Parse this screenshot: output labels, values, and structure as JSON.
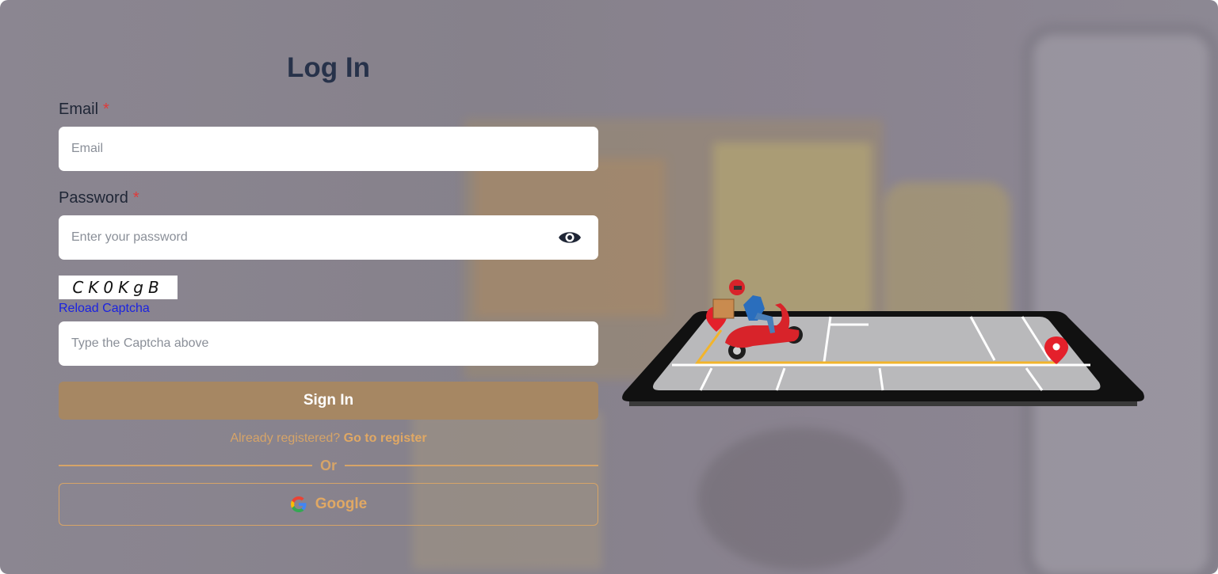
{
  "login": {
    "title": "Log In",
    "email_label": "Email",
    "email_placeholder": "Email",
    "password_label": "Password",
    "password_placeholder": "Enter your password",
    "required_mark": "*",
    "captcha_text": "CK0KgB",
    "reload_captcha": "Reload Captcha",
    "captcha_placeholder": "Type the Captcha above",
    "signin_label": "Sign In",
    "already_registered": "Already registered?",
    "go_to_register": "Go to register",
    "or_label": "Or",
    "google_label": "Google"
  },
  "icons": {
    "password_toggle": "eye-icon",
    "google": "google-icon",
    "illustration": "scooter-delivery-phone-illustration"
  },
  "colors": {
    "accent": "#d6a468",
    "signin_button": "#a68763",
    "title": "#27324a",
    "required": "#e03a3a",
    "link": "#1b22e0"
  }
}
